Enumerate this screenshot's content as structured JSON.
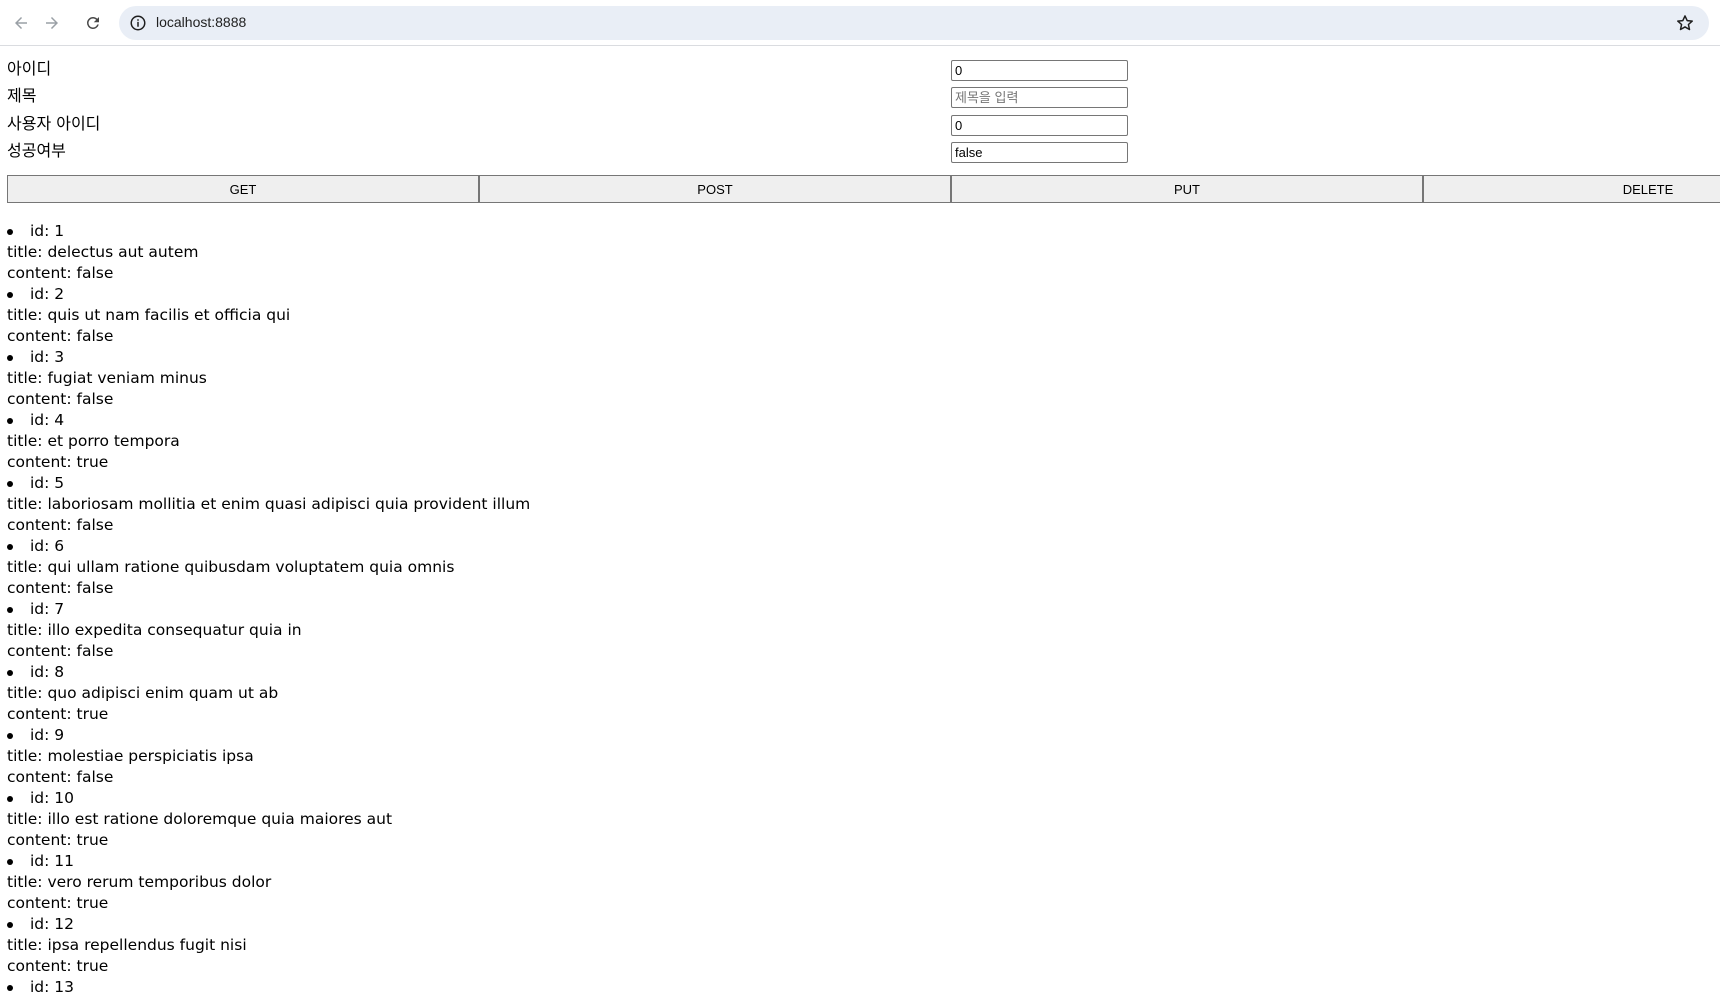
{
  "browser": {
    "url": "localhost:8888"
  },
  "form": {
    "id_label": "아이디",
    "id_value": "0",
    "title_label": "제목",
    "title_value": "",
    "title_placeholder": "제목을 입력",
    "user_id_label": "사용자 아이디",
    "user_id_value": "0",
    "success_label": "성공여부",
    "success_value": "false"
  },
  "buttons": {
    "get": "GET",
    "post": "POST",
    "put": "PUT",
    "delete": "DELETE"
  },
  "items": [
    {
      "id": "id: 1",
      "title": "title: delectus aut autem",
      "content": "content: false"
    },
    {
      "id": "id: 2",
      "title": "title: quis ut nam facilis et officia qui",
      "content": "content: false"
    },
    {
      "id": "id: 3",
      "title": "title: fugiat veniam minus",
      "content": "content: false"
    },
    {
      "id": "id: 4",
      "title": "title: et porro tempora",
      "content": "content: true"
    },
    {
      "id": "id: 5",
      "title": "title: laboriosam mollitia et enim quasi adipisci quia provident illum",
      "content": "content: false"
    },
    {
      "id": "id: 6",
      "title": "title: qui ullam ratione quibusdam voluptatem quia omnis",
      "content": "content: false"
    },
    {
      "id": "id: 7",
      "title": "title: illo expedita consequatur quia in",
      "content": "content: false"
    },
    {
      "id": "id: 8",
      "title": "title: quo adipisci enim quam ut ab",
      "content": "content: true"
    },
    {
      "id": "id: 9",
      "title": "title: molestiae perspiciatis ipsa",
      "content": "content: false"
    },
    {
      "id": "id: 10",
      "title": "title: illo est ratione doloremque quia maiores aut",
      "content": "content: true"
    },
    {
      "id": "id: 11",
      "title": "title: vero rerum temporibus dolor",
      "content": "content: true"
    },
    {
      "id": "id: 12",
      "title": "title: ipsa repellendus fugit nisi",
      "content": "content: true"
    },
    {
      "id": "id: 13",
      "title": "",
      "content": ""
    }
  ]
}
